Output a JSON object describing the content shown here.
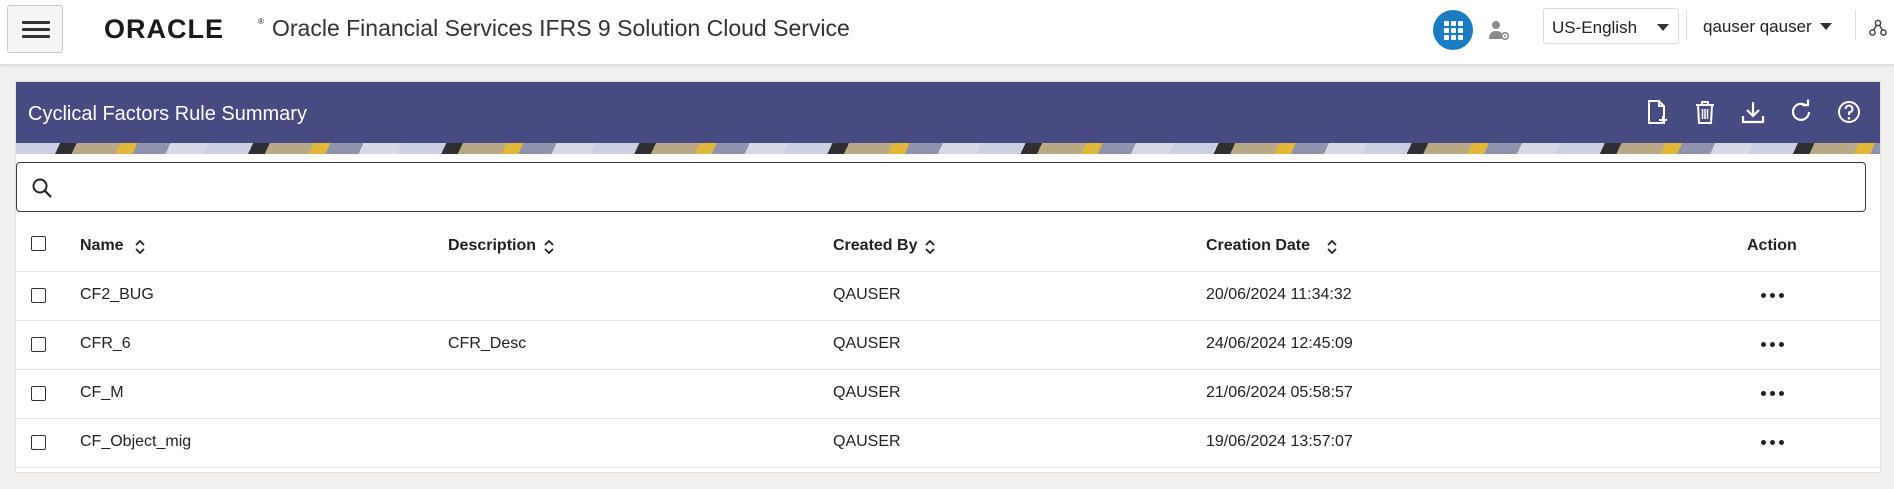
{
  "header": {
    "logo_text": "ORACLE",
    "app_title": "Oracle Financial Services IFRS 9 Solution Cloud Service",
    "language": "US-English",
    "user": "qauser qauser",
    "accent_color": "#1b7bc3"
  },
  "panel": {
    "title": "Cyclical Factors Rule Summary",
    "header_color": "#474b81",
    "toolbar": [
      {
        "name": "add-icon"
      },
      {
        "name": "delete-icon"
      },
      {
        "name": "download-icon"
      },
      {
        "name": "refresh-icon"
      },
      {
        "name": "help-icon"
      }
    ]
  },
  "search": {
    "placeholder": "",
    "value": ""
  },
  "table": {
    "columns": {
      "name": "Name",
      "description": "Description",
      "created_by": "Created By",
      "creation_date": "Creation Date",
      "action": "Action"
    },
    "rows": [
      {
        "name": "CF2_BUG",
        "description": "",
        "created_by": "QAUSER",
        "creation_date": "20/06/2024 11:34:32"
      },
      {
        "name": "CFR_6",
        "description": "CFR_Desc",
        "created_by": "QAUSER",
        "creation_date": "24/06/2024 12:45:09"
      },
      {
        "name": "CF_M",
        "description": "",
        "created_by": "QAUSER",
        "creation_date": "21/06/2024 05:58:57"
      },
      {
        "name": "CF_Object_mig",
        "description": "",
        "created_by": "QAUSER",
        "creation_date": "19/06/2024 13:57:07"
      }
    ]
  }
}
